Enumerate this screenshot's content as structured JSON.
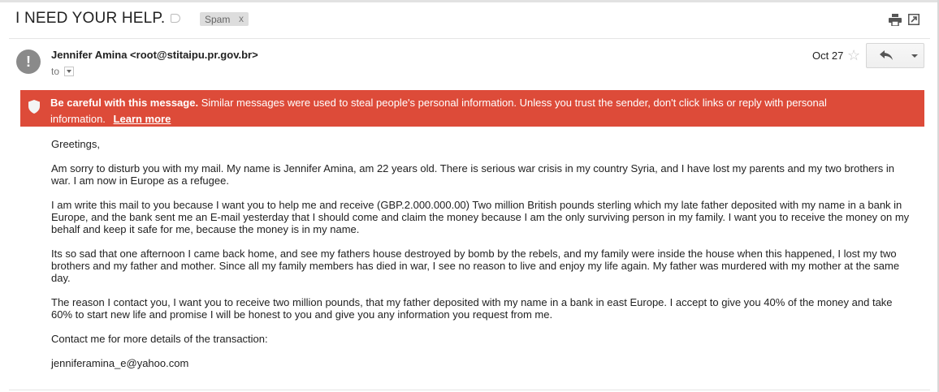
{
  "email": {
    "subject": "I NEED YOUR HELP.",
    "label": "Spam",
    "label_remove": "x",
    "sender": "Jennifer Amina <root@stitaipu.pr.gov.br>",
    "to_label": "to",
    "date": "Oct 27",
    "avatar_glyph": "!"
  },
  "warning": {
    "bold": "Be careful with this message.",
    "text": "Similar messages were used to steal people's personal information. Unless you trust the sender, don't click links or reply with personal information.",
    "link": "Learn more",
    "color": "#dd4b39"
  },
  "body": {
    "paragraphs": [
      "Greetings,",
      "Am sorry to disturb you with my mail. My name is Jennifer Amina, am 22 years old. There is serious war crisis in my country Syria, and I have lost my parents and my two brothers in war. I am now in Europe as a refugee.",
      "I am write this mail to you because I want you to help me and receive (GBP.2.000.000.00) Two million British pounds sterling which my late father deposited with my name in a bank in Europe, and the bank sent me an E-mail yesterday that I should come and claim the money because I am the only surviving person in my family. I want you to receive the money on my behalf and keep it safe for me, because the money is in my name.",
      "Its so sad that one afternoon I came back home, and see my fathers house destroyed by bomb by the rebels, and my family were inside the house when this happened, I lost my two brothers and my father and mother.  Since all my family members has died in war, I see no reason to live and enjoy my life again. My father was murdered with my mother at the same day.",
      "The reason I contact you,  I want you to receive two million pounds, that my father  deposited with my name in a bank in east Europe. I accept to give you 40% of the money and take 60% to start new life and promise I will be honest to you and give you any information you request from me.",
      "Contact me for more details of the transaction:",
      "jenniferamina_e@yahoo.com"
    ]
  },
  "icons": {
    "label": "label-tag-icon",
    "print": "print-icon",
    "popout": "popout-icon",
    "star": "star-icon",
    "reply": "reply-icon",
    "more": "dropdown-arrow-icon",
    "shield": "shield-icon"
  }
}
